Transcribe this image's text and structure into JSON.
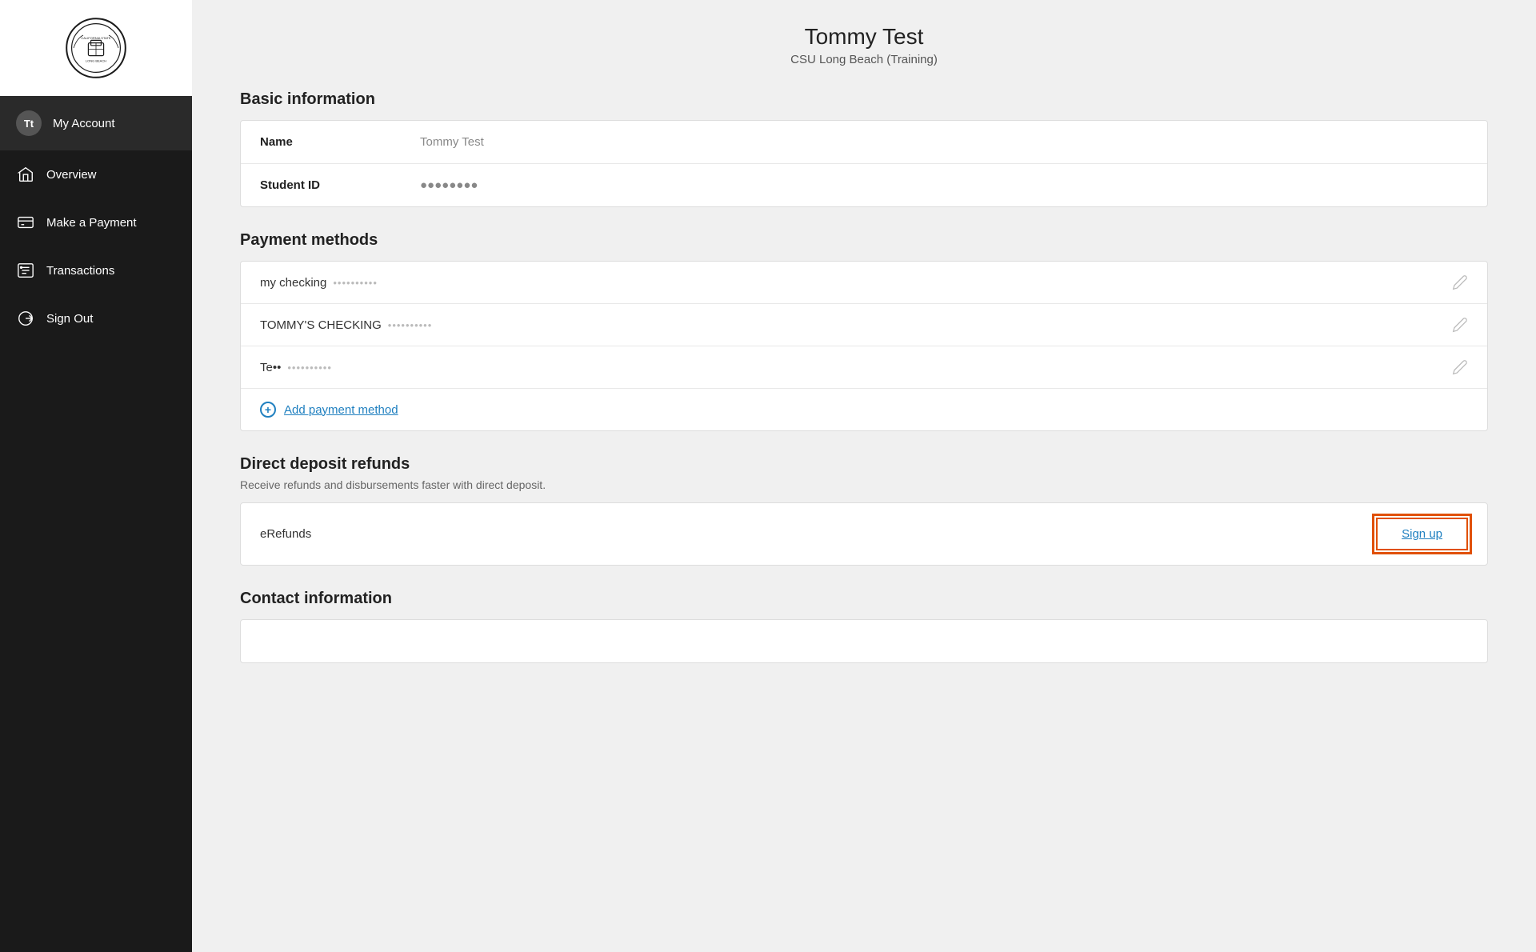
{
  "sidebar": {
    "logo_alt": "CSU Logo",
    "items": [
      {
        "id": "my-account",
        "label": "My Account",
        "icon": "avatar",
        "active": true
      },
      {
        "id": "overview",
        "label": "Overview",
        "icon": "home"
      },
      {
        "id": "make-payment",
        "label": "Make a Payment",
        "icon": "payment"
      },
      {
        "id": "transactions",
        "label": "Transactions",
        "icon": "transactions"
      },
      {
        "id": "sign-out",
        "label": "Sign Out",
        "icon": "signout"
      }
    ]
  },
  "header": {
    "name": "Tommy Test",
    "institution": "CSU Long Beach (Training)"
  },
  "basic_info": {
    "section_title": "Basic information",
    "name_label": "Name",
    "name_value": "Tommy Test",
    "student_id_label": "Student ID",
    "student_id_value": "●●●●●●●●"
  },
  "payment_methods": {
    "section_title": "Payment methods",
    "methods": [
      {
        "name": "my checking",
        "masked": "••••••••••"
      },
      {
        "name": "TOMMY'S CHECKING",
        "masked": "••••••••••"
      },
      {
        "name": "Te••",
        "masked": "••••••••••"
      }
    ],
    "add_label": "Add payment method"
  },
  "direct_deposit": {
    "section_title": "Direct deposit refunds",
    "subtitle": "Receive refunds and disbursements faster with direct deposit.",
    "erefunds_label": "eRefunds",
    "signup_label": "Sign up"
  },
  "contact_info": {
    "section_title": "Contact information"
  }
}
